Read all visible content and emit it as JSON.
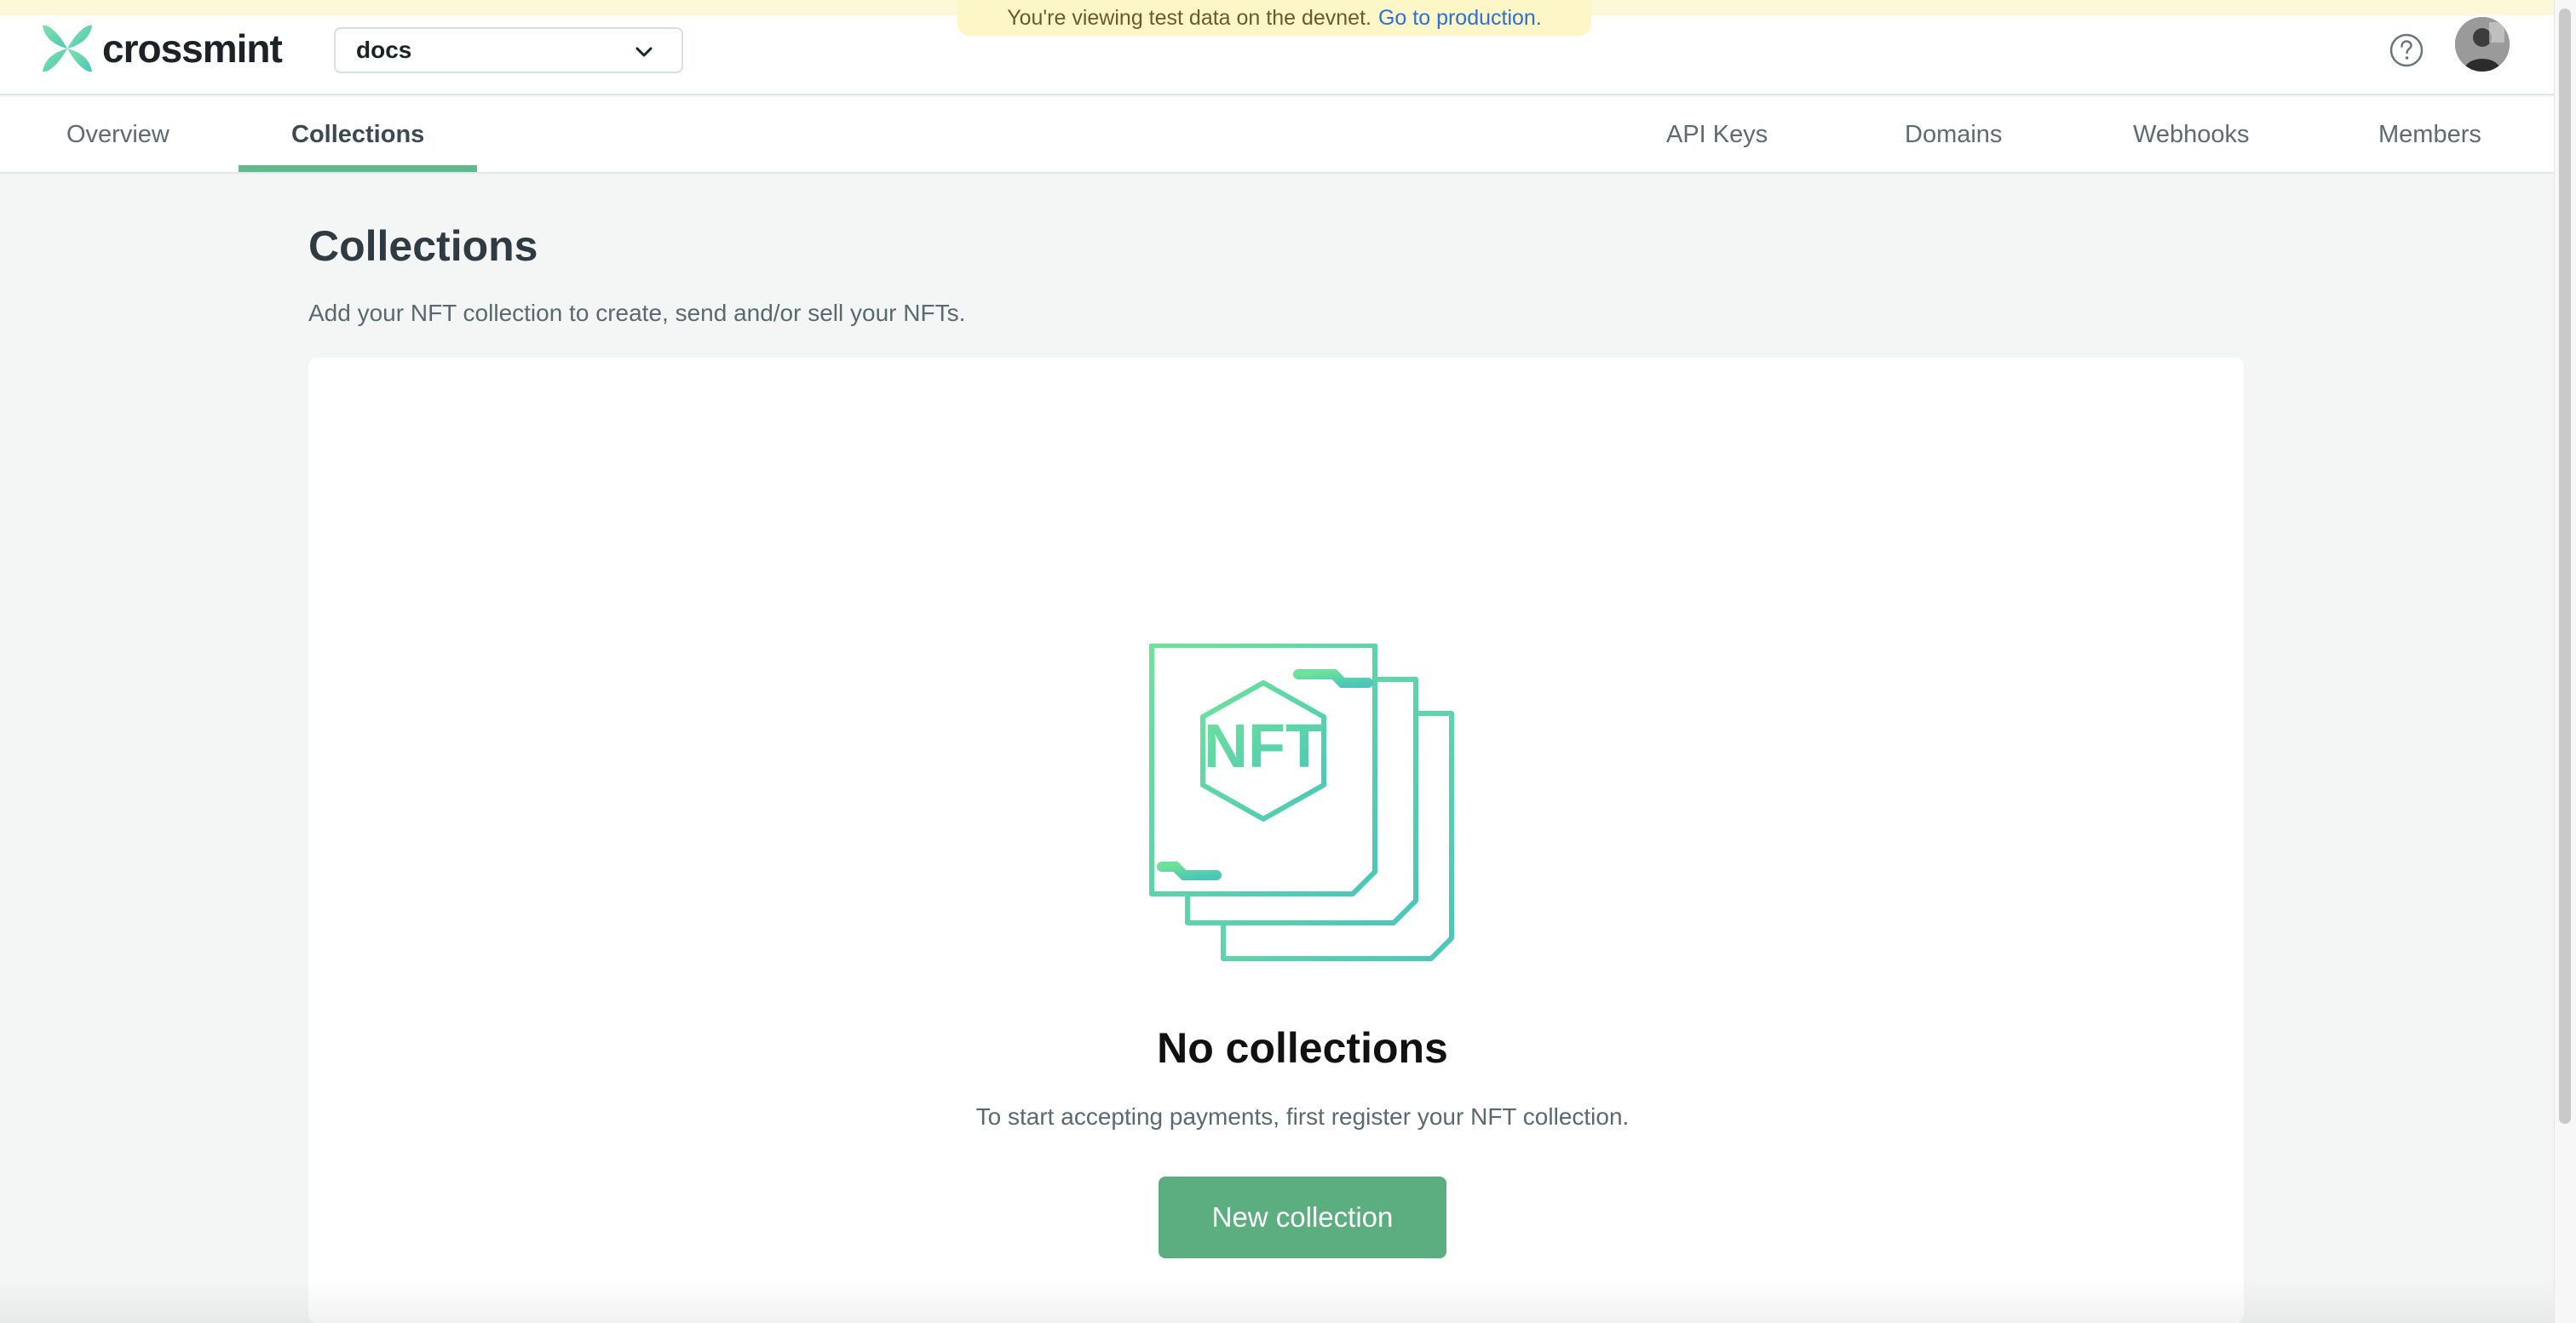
{
  "banner": {
    "message": "You're viewing test data on the devnet.",
    "link_label": "Go to production."
  },
  "header": {
    "logo_text": "crossmint",
    "project_selected": "docs"
  },
  "tabs": {
    "left": [
      {
        "label": "Overview"
      },
      {
        "label": "Collections",
        "active": true
      }
    ],
    "right": [
      {
        "label": "API Keys"
      },
      {
        "label": "Domains"
      },
      {
        "label": "Webhooks"
      },
      {
        "label": "Members"
      }
    ]
  },
  "main": {
    "title": "Collections",
    "subtitle": "Add your NFT collection to create, send and/or sell your NFTs.",
    "empty_state": {
      "illustration_text": "NFT",
      "title": "No collections",
      "description": "To start accepting payments, first register your NFT collection.",
      "button_label": "New collection"
    }
  },
  "colors": {
    "accent": "#5cae80",
    "tab_underline": "#5fb98a",
    "banner_bg": "#fdf6c6",
    "link": "#2f6fd6"
  },
  "icons": [
    "crossmint-logo-icon",
    "chevron-down-icon",
    "help-icon",
    "avatar",
    "nft-stack-icon"
  ]
}
